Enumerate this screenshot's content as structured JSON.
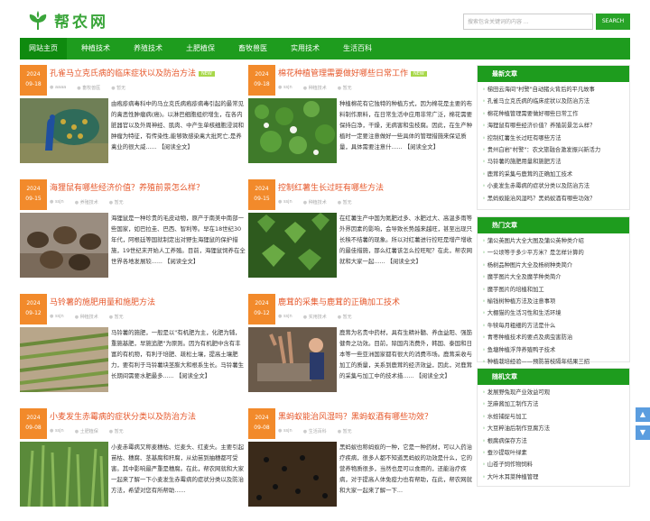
{
  "site": {
    "name": "帮农网"
  },
  "search": {
    "placeholder": "搜索包含关键词的内容 ...",
    "button": "SEARCH"
  },
  "nav": [
    "网站主页",
    "种植技术",
    "养殖技术",
    "土肥植保",
    "畜牧兽医",
    "实用技术",
    "生活百科"
  ],
  "articles": [
    {
      "year": "2024",
      "day": "09-18",
      "title": "孔雀马立克氏病的临床症状以及防治方法",
      "new": "NEW",
      "author": "aaaa",
      "category": "畜牧兽医",
      "comments": "暂无",
      "image": "peacock",
      "desc": "由疱疹病毒科中的马立克氏病疱疹病毒引起的最常见的禽恶性肿瘤病(癌)。以淋巴细胞组织增生，在各内脏器官以及外周神经、肌肉、中产生单核细胞浸润和肿瘤为特征，有传染性,能够致感染禽大批死亡,是养禽业的很大威...... 【阅读全文】"
    },
    {
      "year": "2024",
      "day": "09-18",
      "title": "棉花种植管理需要做好哪些日常工作",
      "new": "NEW",
      "author": "ssjn",
      "category": "种植技术",
      "comments": "暂无",
      "image": "cotton",
      "desc": "种植棉花有它独特的种植方式，因为棉花是主要的布料制作原料，在日常生活中应用非常广泛，棉花需要保持白净，干燥，无病害和虫枝腐。因此，在生产种植时一定要注意做好一些具体的管理措施来保证质量，具体需要注意什...... 【阅读全文】"
    },
    {
      "year": "2024",
      "day": "09-15",
      "title": "海狸鼠有哪些经济价值？养殖前景怎么样？",
      "new": "",
      "author": "ssjn",
      "category": "养殖技术",
      "comments": "暂无",
      "image": "nutria",
      "desc": "海狸鼠是一种珍贵的毛皮动物，原产于南美中南部一些国家，如巴拉圭、巴西、智利等。早在18世纪30年代，阿根廷等国就制定出对野生海狸鼠的保护措施，19世纪末开始人工养殖。目前，海狸鼠饲养在全世界各地发展较...... 【阅读全文】"
    },
    {
      "year": "2024",
      "day": "09-15",
      "title": "控制红薯生长过旺有哪些方法",
      "new": "",
      "author": "ssjn",
      "category": "种植技术",
      "comments": "暂无",
      "image": "sweetpotato",
      "desc": "在红薯生产中国为氮肥过多、水肥过大、高温多雨等外界因素的影响，会导致长势越来越旺，甚至出现只长秧不结薯的现象。所以对红薯进行控旺是增产增收的最佳措施，那么红薯该怎么控旺呢？在此，帮农网就和大家一起...... 【阅读全文】"
    },
    {
      "year": "2024",
      "day": "09-12",
      "title": "马铃薯的施肥用量和施肥方法",
      "new": "",
      "author": "ssjn",
      "category": "种植技术",
      "comments": "暂无",
      "image": "potato",
      "desc": "马铃薯的施肥，一般是以\"有机肥为主，化肥为辅，重施基肥，早施追肥\"为原则。因为有机肥中含有丰富的有机物，有利于培肥、疏松土壤，提高土壤肥力，要有利于马铃薯块茎膨大和根系生长。马铃薯生长期间需要水肥最多...... 【阅读全文】"
    },
    {
      "year": "2024",
      "day": "09-12",
      "title": "鹿茸的采集与鹿茸的正确加工技术",
      "new": "",
      "author": "ssjn",
      "category": "实用技术",
      "comments": "暂无",
      "image": "antler",
      "desc": "鹿茸为名贵中药材，具有生精补髓、养血益阳、强筋健骨之功效。目前，除国内消费外，韩国、泰国和日本等一些亚洲国家都有很大的消费市场。鹿茸采收与加工的质量，关系到鹿茸的经济效益，因此，对鹿茸的采集与加工中的技术措...... 【阅读全文】"
    },
    {
      "year": "2024",
      "day": "09-08",
      "title": "小麦发生赤霉病的症状分类以及防治方法",
      "new": "",
      "author": "ssjn",
      "category": "土肥植保",
      "comments": "暂无",
      "image": "wheat",
      "desc": "小麦赤霉病又称麦穗枯、烂麦头、红麦头。主要引起苗枯、穗腐、茎基腐和秆腐，从幼苗到抽穗都可受害。其中影响最严重是穗腐。在此，帮农网就和大家一起来了解一下小麦发生赤霉病的症状分类以及防治方法，希望对您有所帮助......"
    },
    {
      "year": "2024",
      "day": "09-08",
      "title": "黑蚂蚁能治风湿吗？黑蚂蚁酒有哪些功效？",
      "new": "",
      "author": "ssjn",
      "category": "生活百科",
      "comments": "暂无",
      "image": "ants",
      "desc": "黑蚂蚁也称蚂蚁的一种，它是一种药材，可以入药治疗疾病，很多人都不知道黑蚂蚁的功效是什么，它的营养物质很多，当然也是可以食用的，还能治疗疾病，对于提高人体免疫力也有帮助，在此，帮农网就和大家一起来了解一下..."
    }
  ],
  "sidebar": [
    {
      "title": "最新文章",
      "items": [
        "梯田云海间\"村警\"自动猪火背后的平凡故事",
        "孔雀马立克氏病的临床症状以及防治方法",
        "棉花种植管理需要做好哪些日常工作",
        "海狸鼠有哪些经济价值？养殖前景怎么样？",
        "控制红薯生长过旺有哪些方法",
        "贵州白岩\"村警\"：农文旅融合激发振兴新活力",
        "马铃薯的施肥用量和施肥方法",
        "鹿茸的采集与鹿茸的正确加工技术",
        "小麦发生赤霉病的症状分类以及防治方法",
        "黑蚂蚁能治风湿吗？黑蚂蚁酒有哪些功效？"
      ]
    },
    {
      "title": "热门文章",
      "items": [
        "蒲公英图片大全大图及蒲公英种类介绍",
        "一公顷等于多少平方米？是怎样计算的",
        "杨树品种图片大全及杨树种类简介",
        "魔芋图片大全及魔芋种类简介",
        "魔芋图片的培植和加工",
        "榆钱树种植方法及注意事项",
        "大棚猫的生活习性和生活环境",
        "牛犊每月粗细的方法是什么",
        "青枣种植技术的要点及病虫害防治",
        "鱼塘种植浮萍养殖鸭子技术",
        "种植栽培经验——预防苗枝隔年结果三招"
      ]
    },
    {
      "title": "随机文章",
      "items": [
        "发展野兔现产业效益可观",
        "芝麻酱加工制作方法",
        "水蛭捕捉与加工",
        "大豆粹油后制作豆腐方法",
        "根腐病保存方法",
        "蚕沙提取叶绿素",
        "山苍子饲作物饲料",
        "大叶木耳菜种植管理"
      ]
    }
  ],
  "totop": [
    "▲",
    "▼"
  ]
}
